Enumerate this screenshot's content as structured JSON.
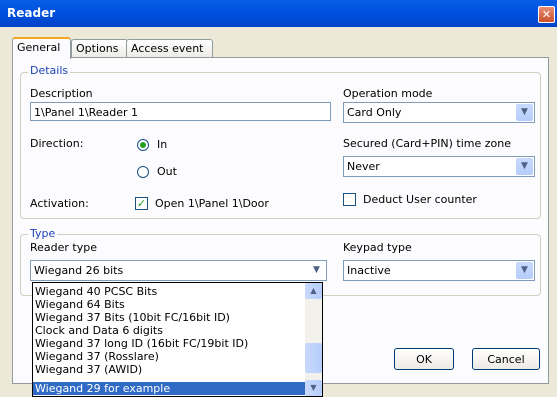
{
  "window": {
    "title": "Reader",
    "close_glyph": "✕"
  },
  "tabs": [
    {
      "label": "General",
      "active": true
    },
    {
      "label": "Options",
      "active": false
    },
    {
      "label": "Access event",
      "active": false
    }
  ],
  "details": {
    "legend": "Details",
    "description_label": "Description",
    "description_value": "1\\Panel 1\\Reader 1",
    "operation_mode_label": "Operation mode",
    "operation_mode_value": "Card Only",
    "direction_label": "Direction:",
    "direction_in": "In",
    "direction_out": "Out",
    "direction_selected": "In",
    "secured_label": "Secured (Card+PIN)  time zone",
    "secured_value": "Never",
    "activation_label": "Activation:",
    "activation_value": "Open 1\\Panel 1\\Door",
    "activation_checked": true,
    "deduct_label": "Deduct User counter",
    "deduct_checked": false
  },
  "type": {
    "legend": "Type",
    "reader_type_label": "Reader type",
    "reader_type_value": "Wiegand 26 bits",
    "keypad_type_label": "Keypad type",
    "keypad_type_value": "Inactive",
    "options": [
      "Wiegand 40 PCSC Bits",
      "Wiegand 64 Bits",
      "Wiegand 37 Bits (10bit FC/16bit ID)",
      "Clock and Data 6 digits",
      "Wiegand 37 long ID (16bit FC/19bit ID)",
      "Wiegand 37 (Rosslare)",
      "Wiegand 37 (AWID)",
      "Wiegand 29 for example"
    ],
    "highlighted_option": "Wiegand 29 for example"
  },
  "buttons": {
    "ok": "OK",
    "cancel": "Cancel"
  },
  "icons": {
    "dropdown_arrow": "chevron-down-icon",
    "scroll_up": "scroll-up-icon",
    "scroll_down": "scroll-down-icon"
  },
  "colors": {
    "titlebar": "#0054e3",
    "legend": "#1e43b2",
    "selection": "#316ac5",
    "check": "#21a121"
  }
}
